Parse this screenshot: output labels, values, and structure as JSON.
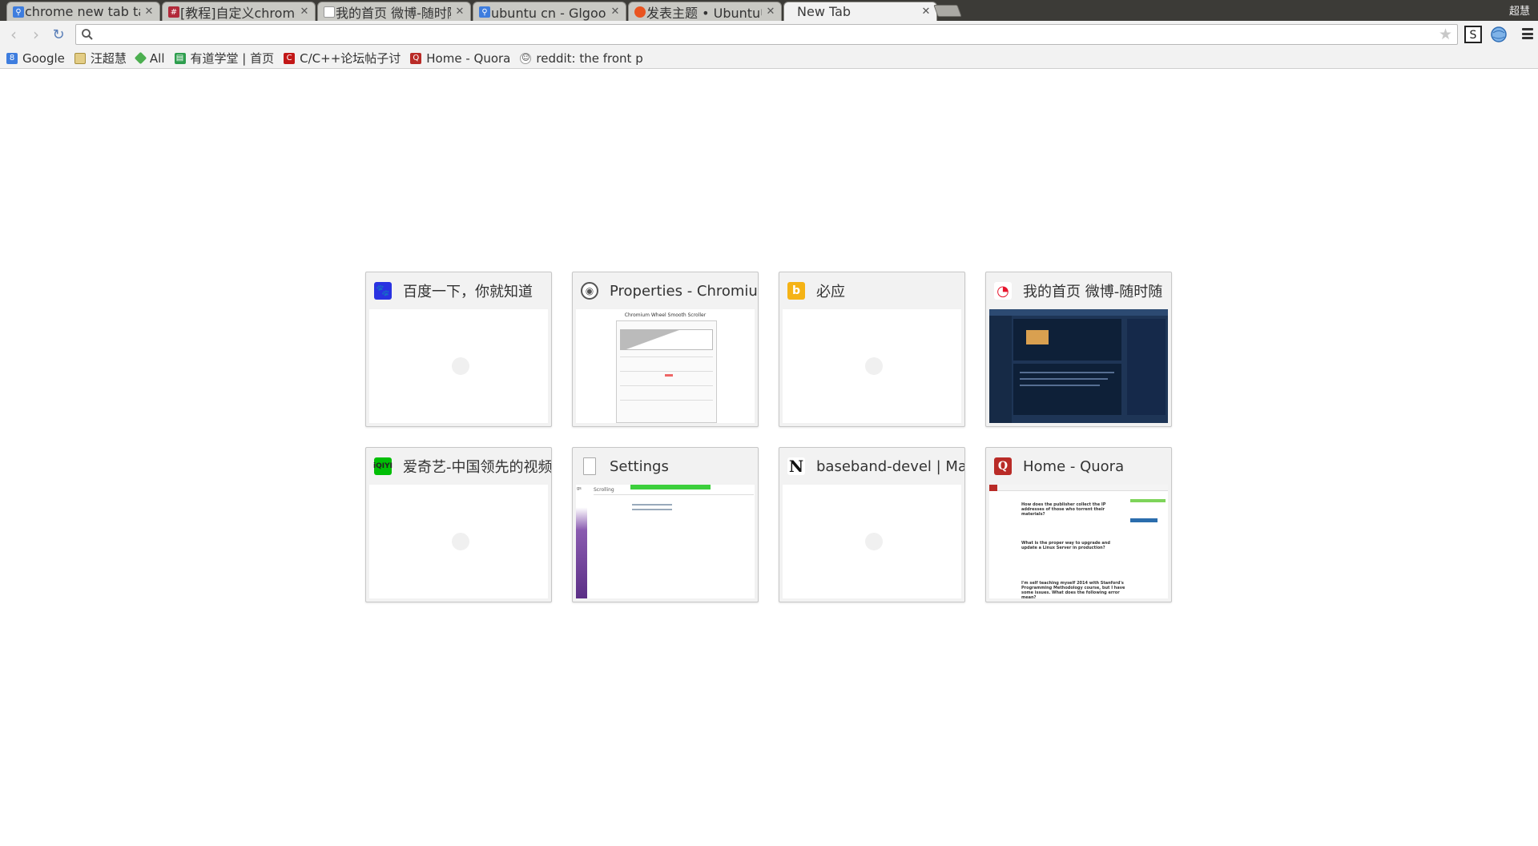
{
  "tabs": [
    {
      "title": "chrome new tab tab",
      "favicon": "search-icon",
      "color": "#3e7dde"
    },
    {
      "title": "[教程]自定义chrome",
      "favicon": "forum-icon",
      "color": "#b22a3a"
    },
    {
      "title": "我的首页 微博-随时随",
      "favicon": "document-icon",
      "color": "#ffffff"
    },
    {
      "title": "ubuntu cn - Glgoo 搜",
      "favicon": "search-icon",
      "color": "#3e7dde"
    },
    {
      "title": "发表主题 • Ubuntu中",
      "favicon": "ubuntu-icon",
      "color": "#e95420"
    },
    {
      "title": "New Tab",
      "favicon": "",
      "color": ""
    }
  ],
  "user_name": "超慧",
  "omnibox": {
    "value": "",
    "placeholder": ""
  },
  "bookmarks": [
    {
      "label": "Google",
      "icon": "google-icon",
      "color": "#3e7dde"
    },
    {
      "label": "汪超慧",
      "icon": "folder-icon",
      "color": "#d9b65b"
    },
    {
      "label": "All",
      "icon": "evernote-icon",
      "color": "#4caf50"
    },
    {
      "label": "有道学堂 | 首页",
      "icon": "youdao-icon",
      "color": "#2e9e4e"
    },
    {
      "label": "C/C++论坛帖子讨",
      "icon": "csdn-icon",
      "color": "#c21717"
    },
    {
      "label": "Home - Quora",
      "icon": "quora-icon",
      "color": "#b92b27"
    },
    {
      "label": "reddit: the front p",
      "icon": "reddit-icon",
      "color": "#ff4500"
    }
  ],
  "most_visited": [
    {
      "title": "百度一下，你就知道",
      "icon": "baidu-icon",
      "color": "#2932e1",
      "thumb": "blank"
    },
    {
      "title": "Properties - Chromium",
      "icon": "chromium-icon",
      "color": "#555555",
      "thumb": "chromium",
      "thumb_text": {
        "heading": "Chromium Wheel Smooth Scroller"
      }
    },
    {
      "title": "必应",
      "icon": "bing-icon",
      "color": "#f5b316",
      "thumb": "blank"
    },
    {
      "title": "我的首页 微博-随时随",
      "icon": "weibo-icon",
      "color": "#e6162d",
      "thumb": "weibo"
    },
    {
      "title": "爱奇艺-中国领先的视频",
      "icon": "iqiyi-icon",
      "color": "#00be06",
      "thumb": "blank"
    },
    {
      "title": "Settings",
      "icon": "document-icon",
      "color": "#888888",
      "thumb": "settings",
      "thumb_text": {
        "sidebar": "gs",
        "heading": "Scrolling"
      }
    },
    {
      "title": "baseband-devel | Mail",
      "icon": "mailman-icon",
      "color": "#111111",
      "thumb": "blank"
    },
    {
      "title": "Home - Quora",
      "icon": "quora-icon",
      "color": "#b92b27",
      "thumb": "quora",
      "thumb_text": {
        "q1": "How does the publisher collect the IP addresses of those who torrent their materials?",
        "q2": "What is the proper way to upgrade and update a Linux Server in production?",
        "q3": "I'm self teaching myself 2014 with Stanford's Programming Methodology course, but I have some issues. What does the following error mean?"
      }
    }
  ]
}
